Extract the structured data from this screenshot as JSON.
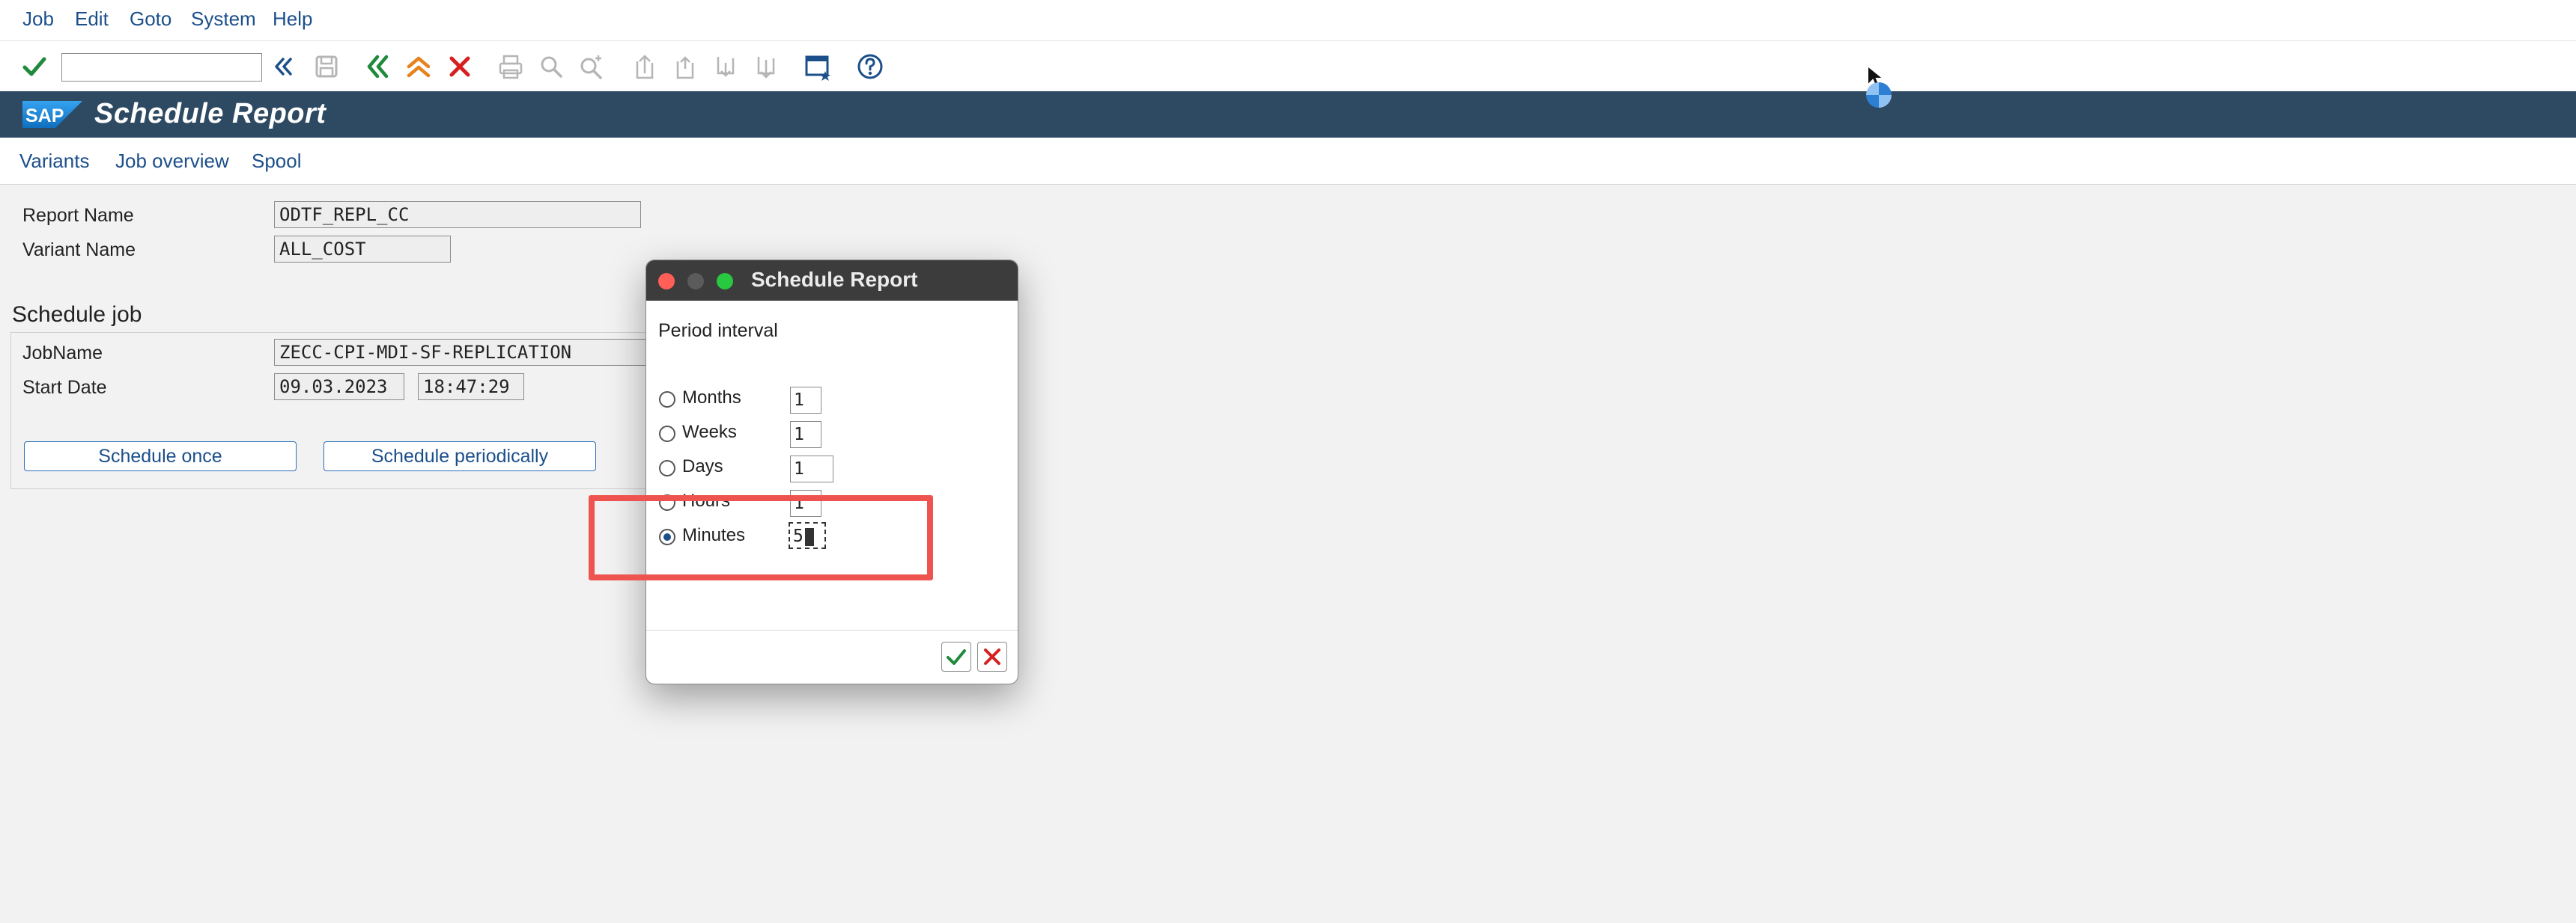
{
  "menu": [
    "Job",
    "Edit",
    "Goto",
    "System",
    "Help"
  ],
  "toolbar": {
    "icons": [
      "enter-icon",
      "back-nav-icon",
      "save-icon",
      "back-icon",
      "exit-icon",
      "cancel-icon",
      "print-icon",
      "find-icon",
      "find-next-icon",
      "first-page-icon",
      "previous-page-icon",
      "next-page-icon",
      "last-page-icon",
      "create-session-icon",
      "help-icon"
    ]
  },
  "title": {
    "logo": "SAP",
    "text": "Schedule Report"
  },
  "app_toolbar": [
    "Variants",
    "Job overview",
    "Spool"
  ],
  "form": {
    "report_name_label": "Report Name",
    "report_name_value": "ODTF_REPL_CC",
    "variant_name_label": "Variant Name",
    "variant_name_value": "ALL_COST",
    "group_title": "Schedule job",
    "jobname_label": "JobName",
    "jobname_value": "ZECC-CPI-MDI-SF-REPLICATION",
    "start_date_label": "Start Date",
    "start_date_value": "09.03.2023",
    "start_time_value": "18:47:29",
    "schedule_once_label": "Schedule once",
    "schedule_periodically_label": "Schedule periodically"
  },
  "dialog": {
    "title": "Schedule Report",
    "section_label": "Period interval",
    "options": [
      {
        "label": "Months",
        "value": "1",
        "selected": false
      },
      {
        "label": "Weeks",
        "value": "1",
        "selected": false
      },
      {
        "label": "Days",
        "value": "1",
        "selected": false
      },
      {
        "label": "Hours",
        "value": "1",
        "selected": false
      },
      {
        "label": "Minutes",
        "value": "5",
        "selected": true
      }
    ]
  },
  "colors": {
    "title_bar": "#2e4a63",
    "link_blue": "#1b4f8a",
    "highlight": "#ef5350",
    "check_green": "#1f8a3b",
    "cancel_red": "#d62020",
    "orange": "#e8821e"
  }
}
